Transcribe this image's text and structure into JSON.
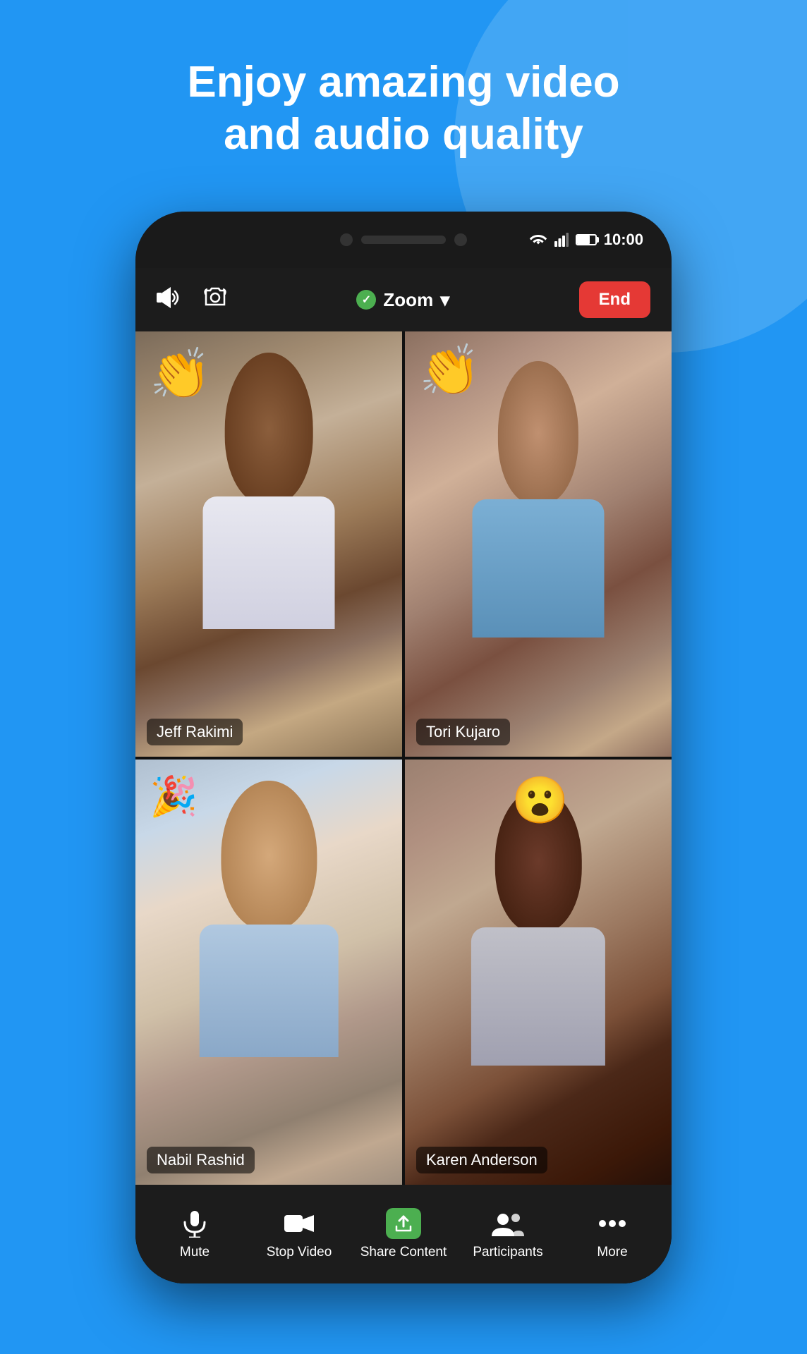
{
  "page": {
    "background_color": "#2196F3",
    "headline_line1": "Enjoy amazing video",
    "headline_line2": "and audio quality"
  },
  "status_bar": {
    "time": "10:00",
    "wifi_icon": "wifi",
    "signal_icon": "signal",
    "battery_icon": "battery"
  },
  "meeting_topbar": {
    "audio_icon": "speaker",
    "camera_flip_icon": "camera-flip",
    "app_name": "Zoom",
    "dropdown_icon": "chevron-down",
    "shield_icon": "shield",
    "end_button_label": "End"
  },
  "participants": [
    {
      "id": "jeff",
      "name": "Jeff Rakimi",
      "emoji": "👏",
      "active_speaker": false,
      "position": "top-left"
    },
    {
      "id": "tori",
      "name": "Tori Kujaro",
      "emoji": "👏",
      "active_speaker": true,
      "position": "top-right"
    },
    {
      "id": "nabil",
      "name": "Nabil Rashid",
      "emoji": "🎉",
      "active_speaker": false,
      "position": "bottom-left"
    },
    {
      "id": "karen",
      "name": "Karen Anderson",
      "emoji": "😮",
      "active_speaker": false,
      "position": "bottom-right"
    }
  ],
  "toolbar": {
    "items": [
      {
        "id": "mute",
        "icon": "microphone",
        "label": "Mute"
      },
      {
        "id": "stop-video",
        "icon": "video-camera",
        "label": "Stop Video"
      },
      {
        "id": "share-content",
        "icon": "share-screen",
        "label": "Share Content"
      },
      {
        "id": "participants",
        "icon": "participants",
        "label": "Participants"
      },
      {
        "id": "more",
        "icon": "ellipsis",
        "label": "More"
      }
    ]
  }
}
